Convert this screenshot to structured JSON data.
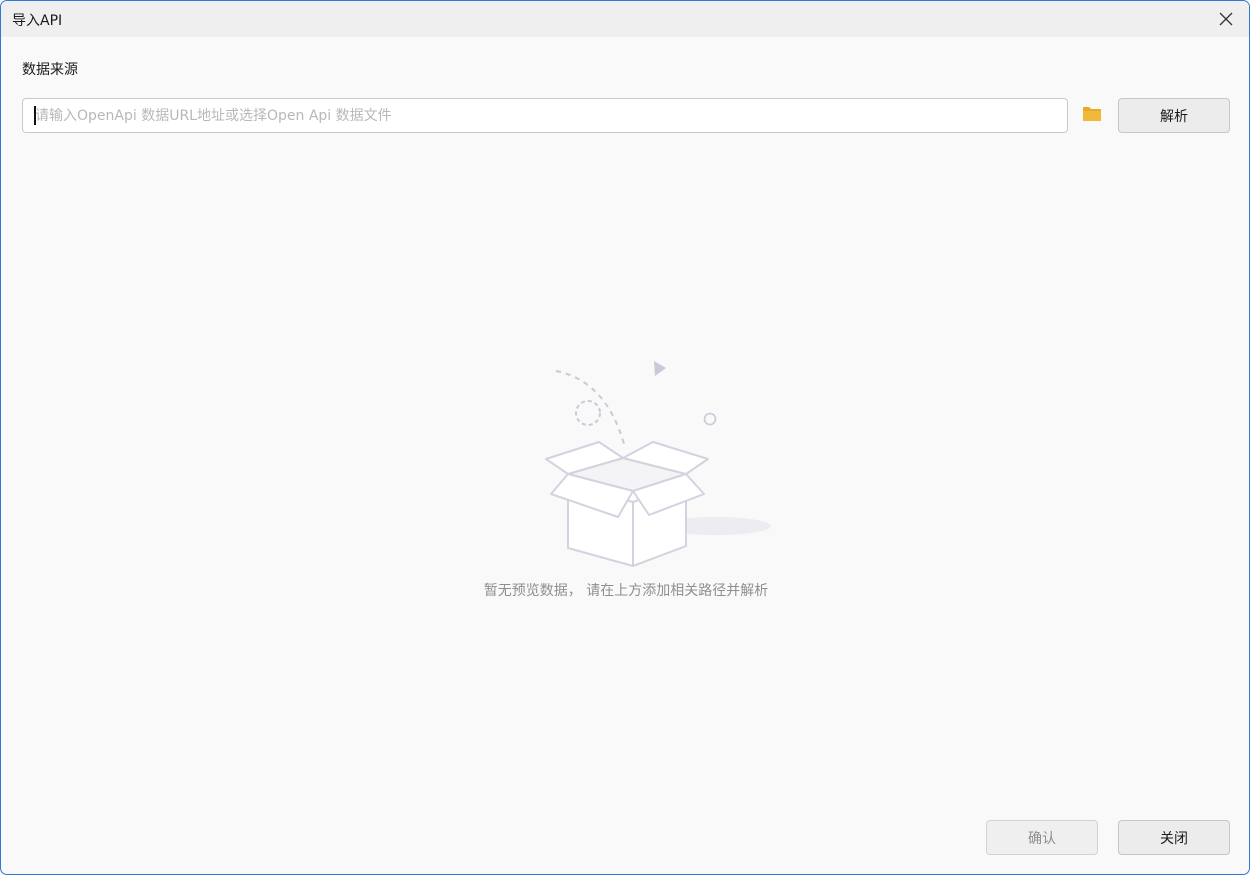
{
  "window": {
    "title": "导入API"
  },
  "source": {
    "label": "数据来源",
    "value": "",
    "placeholder": "请输入OpenApi 数据URL地址或选择Open Api 数据文件",
    "browse_icon": "folder-icon",
    "parse_label": "解析"
  },
  "empty_state": {
    "icon": "empty-box-icon",
    "message": "暂无预览数据， 请在上方添加相关路径并解析"
  },
  "footer": {
    "confirm_label": "确认",
    "close_label": "关闭"
  },
  "colors": {
    "accent_border": "#2b7bd6",
    "folder": "#e8a92a"
  }
}
